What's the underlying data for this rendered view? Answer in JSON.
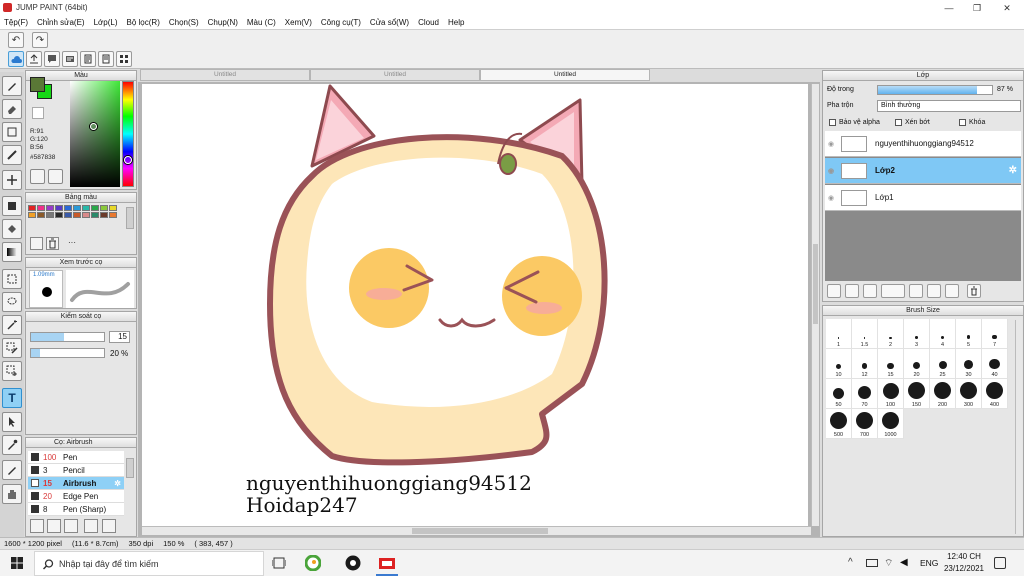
{
  "window": {
    "title": "JUMP PAINT (64bit)",
    "minimize": "—",
    "maximize": "❐",
    "close": "✕"
  },
  "menu": [
    "Tệp(F)",
    "Chỉnh sửa(E)",
    "Lớp(L)",
    "Bộ lọc(R)",
    "Chọn(S)",
    "Chụp(N)",
    "Màu (C)",
    "Xem(V)",
    "Công cụ(T)",
    "Cửa sổ(W)",
    "Cloud",
    "Help"
  ],
  "toolbar": {
    "undo": "↶",
    "redo": "↷"
  },
  "tabs": [
    "Untitled",
    "Untitled",
    "Untitled"
  ],
  "color_panel": {
    "title": "Màu",
    "r": "R:91",
    "g": "G:120",
    "b": "B:56",
    "hex": "#587838",
    "fg": "#5a7836",
    "bg": "#16d816"
  },
  "palette_panel": {
    "title": "Bảng màu",
    "menu": "···",
    "colors": [
      "#e22424",
      "#f0308a",
      "#9a3ac8",
      "#5a3ac8",
      "#2a6ad8",
      "#2a9ad8",
      "#28b8a8",
      "#2aa84a",
      "#8ac83a",
      "#e8d82a",
      "#f0a028",
      "#8a5a2a",
      "#7a7a7a",
      "#2a2a2a",
      "#3a5aa8",
      "#c85a2a",
      "#d88a8a",
      "#2a8a6a",
      "#6a3a2a",
      "#e87830"
    ]
  },
  "brush_preview": {
    "title": "Xem trước cọ",
    "size": "1.09mm"
  },
  "brush_control": {
    "title": "Kiểm soát cọ",
    "size_value": "15",
    "opacity_value": "20 %",
    "size_fill": 0.45,
    "opacity_fill": 0.12
  },
  "brush_list": {
    "title": "Cọ: Airbrush",
    "items": [
      {
        "size": "100",
        "name": "Pen"
      },
      {
        "size": "3",
        "name": "Pencil"
      },
      {
        "size": "15",
        "name": "Airbrush"
      },
      {
        "size": "20",
        "name": "Edge Pen"
      },
      {
        "size": "8",
        "name": "Pen (Sharp)"
      }
    ]
  },
  "layer_panel": {
    "title": "Lớp",
    "opacity_label": "Độ trong",
    "opacity_value": "87 %",
    "opacity_fill": 0.87,
    "blend_label": "Pha trộn",
    "blend_value": "Bình thường",
    "protect_alpha": "Bảo vệ alpha",
    "clipping": "Xén bớt",
    "lock": "Khóa",
    "layers": [
      {
        "name": "nguyenthihuonggiang94512"
      },
      {
        "name": "Lớp2"
      },
      {
        "name": "Lớp1"
      }
    ]
  },
  "brush_size_panel": {
    "title": "Brush Size",
    "sizes": [
      "1",
      "1.5",
      "2",
      "3",
      "4",
      "5",
      "7",
      "10",
      "12",
      "15",
      "20",
      "25",
      "30",
      "40",
      "50",
      "70",
      "100",
      "150",
      "200",
      "300",
      "400",
      "500",
      "700",
      "1000"
    ]
  },
  "canvas_text": {
    "line1": "nguyenthihuonggiang94512",
    "line2": "Hoidap247"
  },
  "status": {
    "dimensions": "1600 * 1200 pixel",
    "physical": "(11.6 * 8.7cm)",
    "dpi": "350 dpi",
    "zoom": "150 %",
    "coords": "( 383, 457 )"
  },
  "taskbar": {
    "search_placeholder": "Nhập tại đây để tìm kiếm",
    "time": "12:40 CH",
    "date": "23/12/2021",
    "lang": "ENG",
    "tray_chevron": "^"
  }
}
